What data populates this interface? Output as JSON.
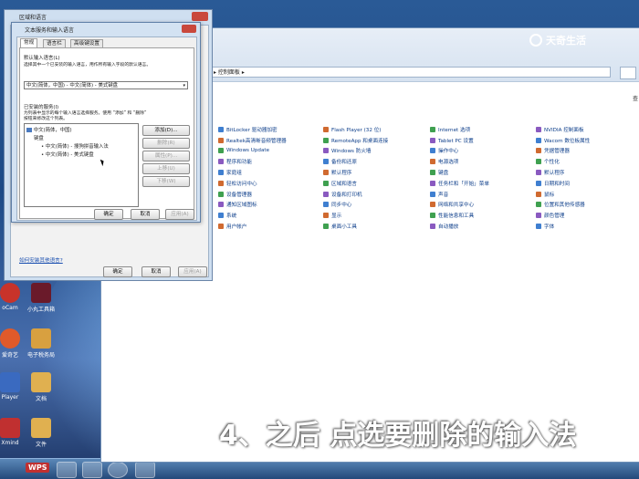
{
  "watermark": {
    "brand": "天奇生活"
  },
  "caption": "4、之后 点选要删除的输入法",
  "desktop": {
    "icons": [
      {
        "label": "oCam",
        "color": "#c8332a"
      },
      {
        "label": "小丸工具箱",
        "color": "#6a1a2a"
      },
      {
        "label": "爱奇艺",
        "color": "#e05a2a"
      },
      {
        "label": "电子税务局",
        "color": "#d8a040"
      },
      {
        "label": "Player",
        "color": "#3a6ac0"
      },
      {
        "label": "文档",
        "color": "#e0b050"
      },
      {
        "label": "Xmind",
        "color": "#c03030"
      },
      {
        "label": "文件",
        "color": "#e0b050"
      }
    ],
    "taskbar_label": "WPS"
  },
  "control_panel": {
    "address": "▸ 控制面板 ▸",
    "view_label": "查",
    "items": [
      [
        "BitLocker 驱动器加密",
        "Realtek高清晰音频管理器",
        "Windows Update",
        "程序和功能",
        "家庭组",
        "轻松访问中心",
        "设备管理器",
        "通知区域图标",
        "系统",
        "用户帐户"
      ],
      [
        "Flash Player (32 位)",
        "RemoteApp 和桌面连接",
        "Windows 防火墙",
        "备份和还原",
        "默认程序",
        "区域和语言",
        "设备和打印机",
        "同步中心",
        "显示",
        "桌面小工具"
      ],
      [
        "Internet 选项",
        "Tablet PC 设置",
        "操作中心",
        "电源选项",
        "键盘",
        "任务栏和「开始」菜单",
        "声音",
        "网络和共享中心",
        "性能信息和工具",
        "自动播放"
      ],
      [
        "NVIDIA 控制面板",
        "Wacom 数位板属性",
        "凭据管理器",
        "个性化",
        "默认程序",
        "日期和时间",
        "鼠标",
        "位置和其他传感器",
        "颜色管理",
        "字体"
      ]
    ],
    "colors": [
      "#3f7fd0",
      "#d06a30",
      "#3fa050",
      "#8a5ac0"
    ]
  },
  "region_dialog": {
    "title": "区域和语言",
    "link": "如何安装其他语言?",
    "ok": "确定",
    "cancel": "取消",
    "apply": "应用(A)"
  },
  "text_services": {
    "title": "文本服务和输入语言",
    "tabs": [
      "常规",
      "语言栏",
      "高级键设置"
    ],
    "default_lang_title": "默认输入语言(L)",
    "default_lang_desc": "选择其中一个已安装的输入语言，用作所有输入字段的默认语言。",
    "default_lang_value": "中文(简体，中国) - 中文(简体) - 美式键盘",
    "installed_title": "已安装的服务(I)",
    "installed_desc1": "为列表中显示的每个输入语言选择服务。使用 “添加” 和 “删除”",
    "installed_desc2": "按钮来修改这个列表。",
    "tree": {
      "root": "中文(简体，中国)",
      "keyboard": "键盘",
      "item1": "中文(简体) - 搜狗拼音输入法",
      "item2": "中文(简体) - 美式键盘"
    },
    "buttons": {
      "add": "添加(D)...",
      "remove": "删除(R)",
      "properties": "属性(P)...",
      "up": "上移(U)",
      "down": "下移(W)"
    },
    "ok": "确定",
    "cancel": "取消",
    "apply": "应用(A)"
  }
}
